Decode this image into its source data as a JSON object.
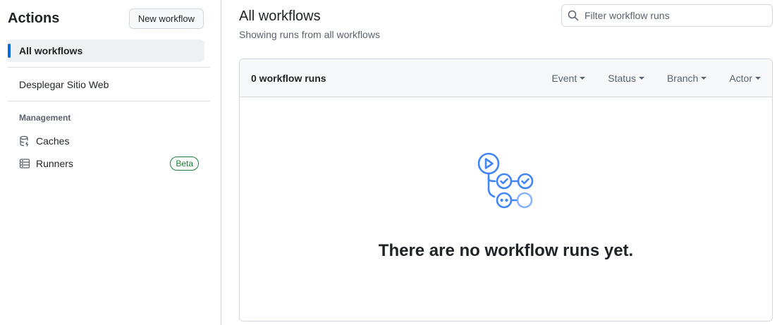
{
  "sidebar": {
    "title": "Actions",
    "new_workflow_label": "New workflow",
    "all_workflows_label": "All workflows",
    "workflows": [
      "Desplegar Sitio Web"
    ],
    "management_label": "Management",
    "management_items": [
      {
        "label": "Caches",
        "icon": "database-icon"
      },
      {
        "label": "Runners",
        "icon": "server-icon",
        "badge": "Beta"
      }
    ]
  },
  "main": {
    "title": "All workflows",
    "subtitle": "Showing runs from all workflows",
    "search": {
      "placeholder": "Filter workflow runs",
      "value": ""
    },
    "run_count": "0 workflow runs",
    "filters": [
      "Event",
      "Status",
      "Branch",
      "Actor"
    ],
    "empty_message": "There are no workflow runs yet."
  },
  "colors": {
    "accent": "#0969da",
    "success": "#1a7f37",
    "illustration": "#4285f4",
    "muted_text": "#59636e"
  }
}
